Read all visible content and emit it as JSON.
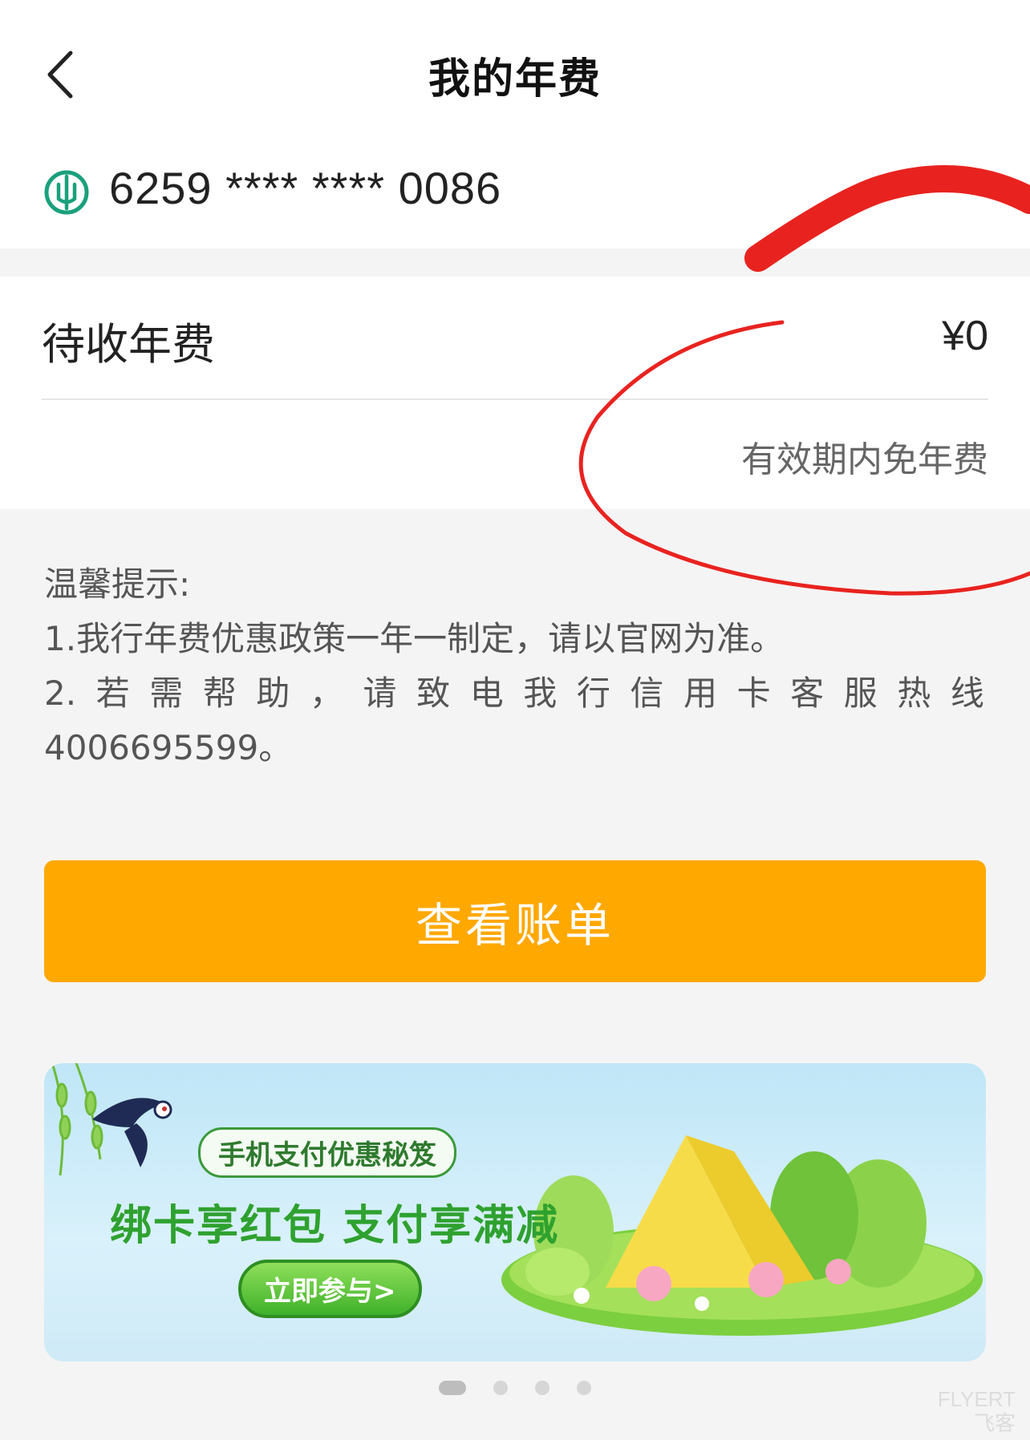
{
  "nav": {
    "title": "我的年费"
  },
  "card": {
    "number": "6259 **** **** 0086"
  },
  "fee": {
    "label": "待收年费",
    "amount": "¥0",
    "note": "有效期内免年费"
  },
  "tips": {
    "heading": "温馨提示:",
    "line1": "1.我行年费优惠政策一年一制定，请以官网为准。",
    "line2_chars": [
      "2.",
      "若",
      "需",
      "帮",
      "助",
      "，",
      "请",
      "致",
      "电",
      "我",
      "行",
      "信",
      "用",
      "卡",
      "客",
      "服",
      "热",
      "线"
    ],
    "line3": "4006695599。"
  },
  "actions": {
    "view_bill": "查看账单"
  },
  "banner": {
    "pill": "手机支付优惠秘笈",
    "headline": "绑卡享红包 支付享满减",
    "cta": "立即参与>"
  },
  "carousel": {
    "total": 4,
    "active": 1
  },
  "watermark": {
    "line1": "FLYERT",
    "line2": "飞客"
  },
  "colors": {
    "button": "#ffa800",
    "annotation": "#e8231f",
    "bank_logo": "#1aa07c"
  }
}
